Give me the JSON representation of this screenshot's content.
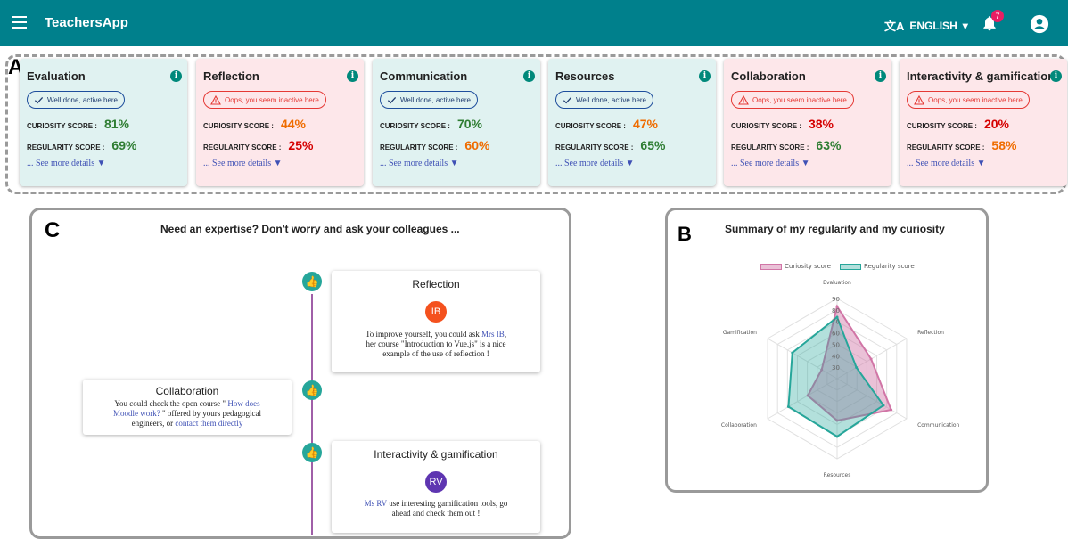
{
  "appbar": {
    "title": "TeachersApp",
    "language": "ENGLISH",
    "notification_count": "7"
  },
  "labels": {
    "a": "A",
    "b": "B",
    "c": "C"
  },
  "cards": [
    {
      "title": "Evaluation",
      "state": "good",
      "status": "Well done, active here",
      "curiosity_label": "CURIOSITY SCORE :",
      "curiosity": "81%",
      "curiosity_color": "green",
      "regularity_label": "REGULARITY SCORE :",
      "regularity": "69%",
      "regularity_color": "green",
      "more": "... See more details ▼"
    },
    {
      "title": "Reflection",
      "state": "bad",
      "status": "Oops, you seem inactive here",
      "curiosity_label": "CURIOSITY SCORE :",
      "curiosity": "44%",
      "curiosity_color": "orange",
      "regularity_label": "REGULARITY SCORE :",
      "regularity": "25%",
      "regularity_color": "red",
      "more": "... See more details ▼"
    },
    {
      "title": "Communication",
      "state": "good",
      "status": "Well done, active here",
      "curiosity_label": "CURIOSITY SCORE :",
      "curiosity": "70%",
      "curiosity_color": "green",
      "regularity_label": "REGULARITY SCORE :",
      "regularity": "60%",
      "regularity_color": "orange",
      "more": "... See more details ▼"
    },
    {
      "title": "Resources",
      "state": "good",
      "status": "Well done, active here",
      "curiosity_label": "CURIOSITY SCORE :",
      "curiosity": "47%",
      "curiosity_color": "orange",
      "regularity_label": "REGULARITY SCORE :",
      "regularity": "65%",
      "regularity_color": "green",
      "more": "... See more details ▼"
    },
    {
      "title": "Collaboration",
      "state": "bad",
      "status": "Oops, you seem inactive here",
      "curiosity_label": "CURIOSITY SCORE :",
      "curiosity": "38%",
      "curiosity_color": "red",
      "regularity_label": "REGULARITY SCORE :",
      "regularity": "63%",
      "regularity_color": "green",
      "more": "... See more details ▼"
    },
    {
      "title": "Interactivity & gamification",
      "state": "bad",
      "status": "Oops, you seem inactive here",
      "curiosity_label": "CURIOSITY SCORE :",
      "curiosity": "20%",
      "curiosity_color": "red",
      "regularity_label": "REGULARITY SCORE :",
      "regularity": "58%",
      "regularity_color": "orange",
      "more": "... See more details ▼"
    }
  ],
  "expertise": {
    "title": "Need an expertise? Don't worry and ask your colleagues ...",
    "reflection": {
      "title": "Reflection",
      "avatar": "IB",
      "avatar_color": "#f4511e",
      "text_1": "To improve yourself, you could ask ",
      "link": "Mrs IB",
      "text_2": ",",
      "text_3": "her course \"Introduction to Vue.js\" is a nice",
      "text_4": "example of the use of reflection !"
    },
    "collaboration": {
      "title": "Collaboration",
      "text_1": "You could check the open course \" ",
      "link_1": "How does",
      "link_1b": "Moodle work?",
      "text_2": " \" offered by yours pedagogical",
      "text_3": "engineers, or ",
      "link_2": "contact them directly"
    },
    "interactivity": {
      "title": "Interactivity & gamification",
      "avatar": "RV",
      "avatar_color": "#5e35b1",
      "link": "Ms RV",
      "text_1": " use interesting gamification tools, go",
      "text_2": "ahead and check them out !"
    }
  },
  "chart_data": {
    "type": "radar",
    "title": "Summary of my regularity and my curiosity",
    "categories": [
      "Evaluation",
      "Reflection",
      "Communication",
      "Resources",
      "Collaboration",
      "Gamification"
    ],
    "series": [
      {
        "name": "Curiosity score",
        "values": [
          81,
          44,
          70,
          47,
          38,
          20
        ],
        "color": "#d175a6"
      },
      {
        "name": "Regularity score",
        "values": [
          69,
          25,
          60,
          65,
          63,
          58
        ],
        "color": "#26a69a"
      }
    ],
    "rlim": [
      0,
      90
    ],
    "ticks": [
      "30",
      "40",
      "50",
      "60",
      "70",
      "80",
      "90"
    ]
  }
}
